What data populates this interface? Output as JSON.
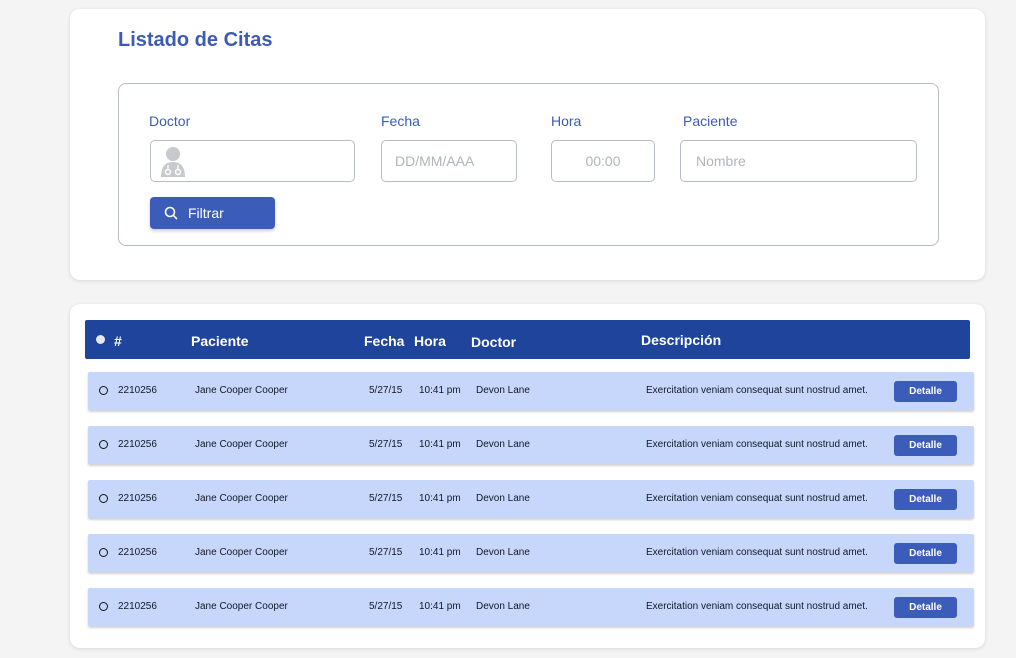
{
  "filters": {
    "title": "Listado de Citas",
    "doctor_label": "Doctor",
    "fecha_label": "Fecha",
    "fecha_placeholder": "DD/MM/AAA",
    "hora_label": "Hora",
    "hora_placeholder": "00:00",
    "paciente_label": "Paciente",
    "paciente_placeholder": "Nombre",
    "filter_button": "Filtrar",
    "icons": [
      "doctor-avatar-icon",
      "search-icon"
    ]
  },
  "table": {
    "headers": {
      "number": "#",
      "patient": "Paciente",
      "date": "Fecha",
      "time": "Hora",
      "doctor": "Doctor",
      "description": "Descripción"
    },
    "rows": [
      {
        "id": "2210256",
        "patient": "Jane Cooper Cooper",
        "date": "5/27/15",
        "time": "10:41 pm",
        "doctor": "Devon Lane",
        "description": "Exercitation veniam consequat sunt nostrud amet.",
        "action": "Detalle"
      },
      {
        "id": "2210256",
        "patient": "Jane Cooper Cooper",
        "date": "5/27/15",
        "time": "10:41 pm",
        "doctor": "Devon Lane",
        "description": "Exercitation veniam consequat sunt nostrud amet.",
        "action": "Detalle"
      },
      {
        "id": "2210256",
        "patient": "Jane Cooper Cooper",
        "date": "5/27/15",
        "time": "10:41 pm",
        "doctor": "Devon Lane",
        "description": "Exercitation veniam consequat sunt nostrud amet.",
        "action": "Detalle"
      },
      {
        "id": "2210256",
        "patient": "Jane Cooper Cooper",
        "date": "5/27/15",
        "time": "10:41 pm",
        "doctor": "Devon Lane",
        "description": "Exercitation veniam consequat sunt nostrud amet.",
        "action": "Detalle"
      },
      {
        "id": "2210256",
        "patient": "Jane Cooper Cooper",
        "date": "5/27/15",
        "time": "10:41 pm",
        "doctor": "Devon Lane",
        "description": "Exercitation veniam consequat sunt nostrud amet.",
        "action": "Detalle"
      }
    ]
  },
  "colors": {
    "accent": "#3b5cb8",
    "header_bg": "#1f449c",
    "row_bg": "#c7d7fb",
    "title": "#3d5bb5"
  }
}
